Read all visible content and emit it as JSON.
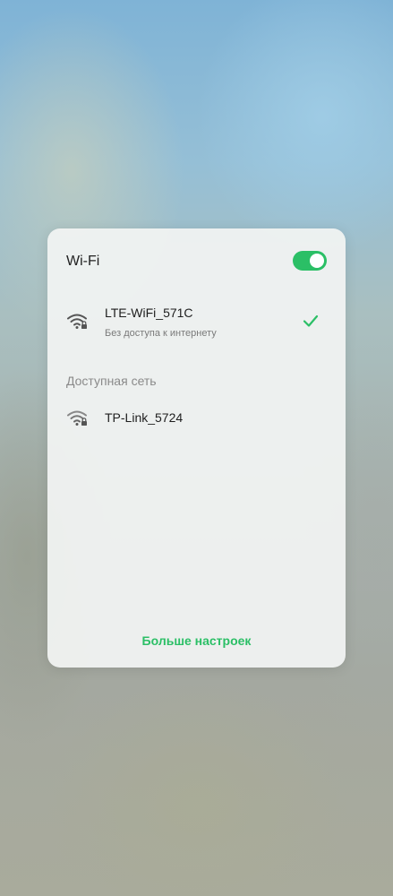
{
  "wifi_panel": {
    "title": "Wi-Fi",
    "toggle_on": true,
    "accent_color": "#2bbf66",
    "connected_network": {
      "name": "LTE-WiFi_571C",
      "status": "Без доступа к интернету",
      "icon": "wifi-locked-icon",
      "selected_icon": "checkmark-icon"
    },
    "available_label": "Доступная сеть",
    "available_networks": [
      {
        "name": "TP-Link_5724",
        "icon": "wifi-locked-icon"
      }
    ],
    "more_settings_label": "Больше настроек"
  }
}
